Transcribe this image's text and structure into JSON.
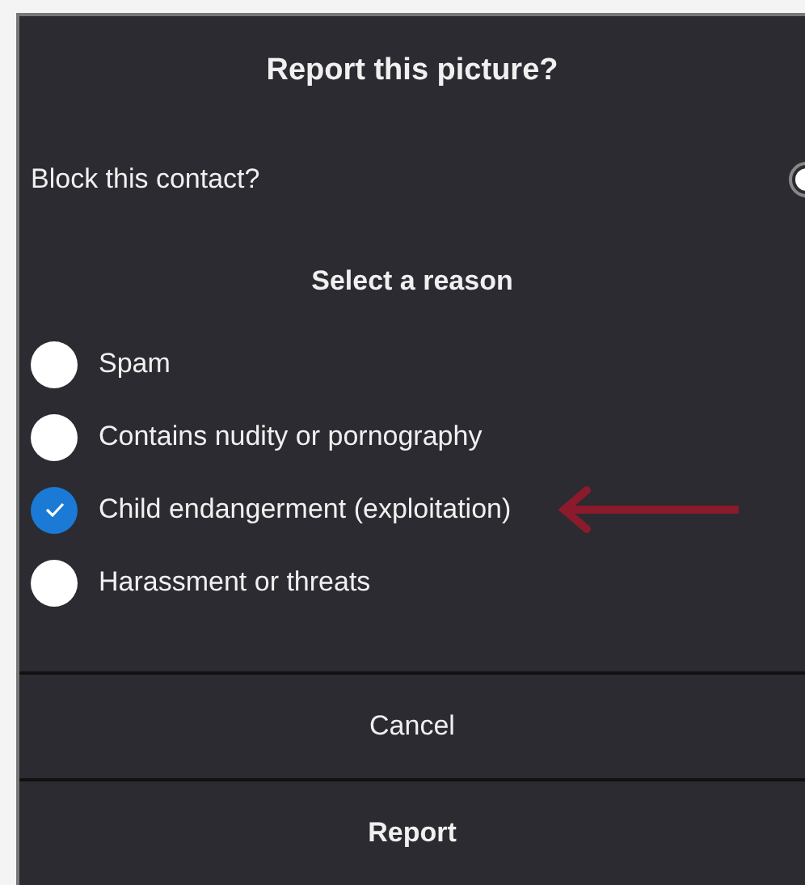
{
  "dialog": {
    "title": "Report this picture?"
  },
  "block_contact": {
    "label": "Block this contact?",
    "on": false
  },
  "reason_heading": "Select a reason",
  "reasons": [
    {
      "label": "Spam",
      "selected": false
    },
    {
      "label": "Contains nudity or pornography",
      "selected": false
    },
    {
      "label": "Child endangerment (exploitation)",
      "selected": true
    },
    {
      "label": "Harassment or threats",
      "selected": false
    }
  ],
  "buttons": [
    {
      "label": "Cancel",
      "kind": "secondary"
    },
    {
      "label": "Report",
      "kind": "primary"
    }
  ]
}
